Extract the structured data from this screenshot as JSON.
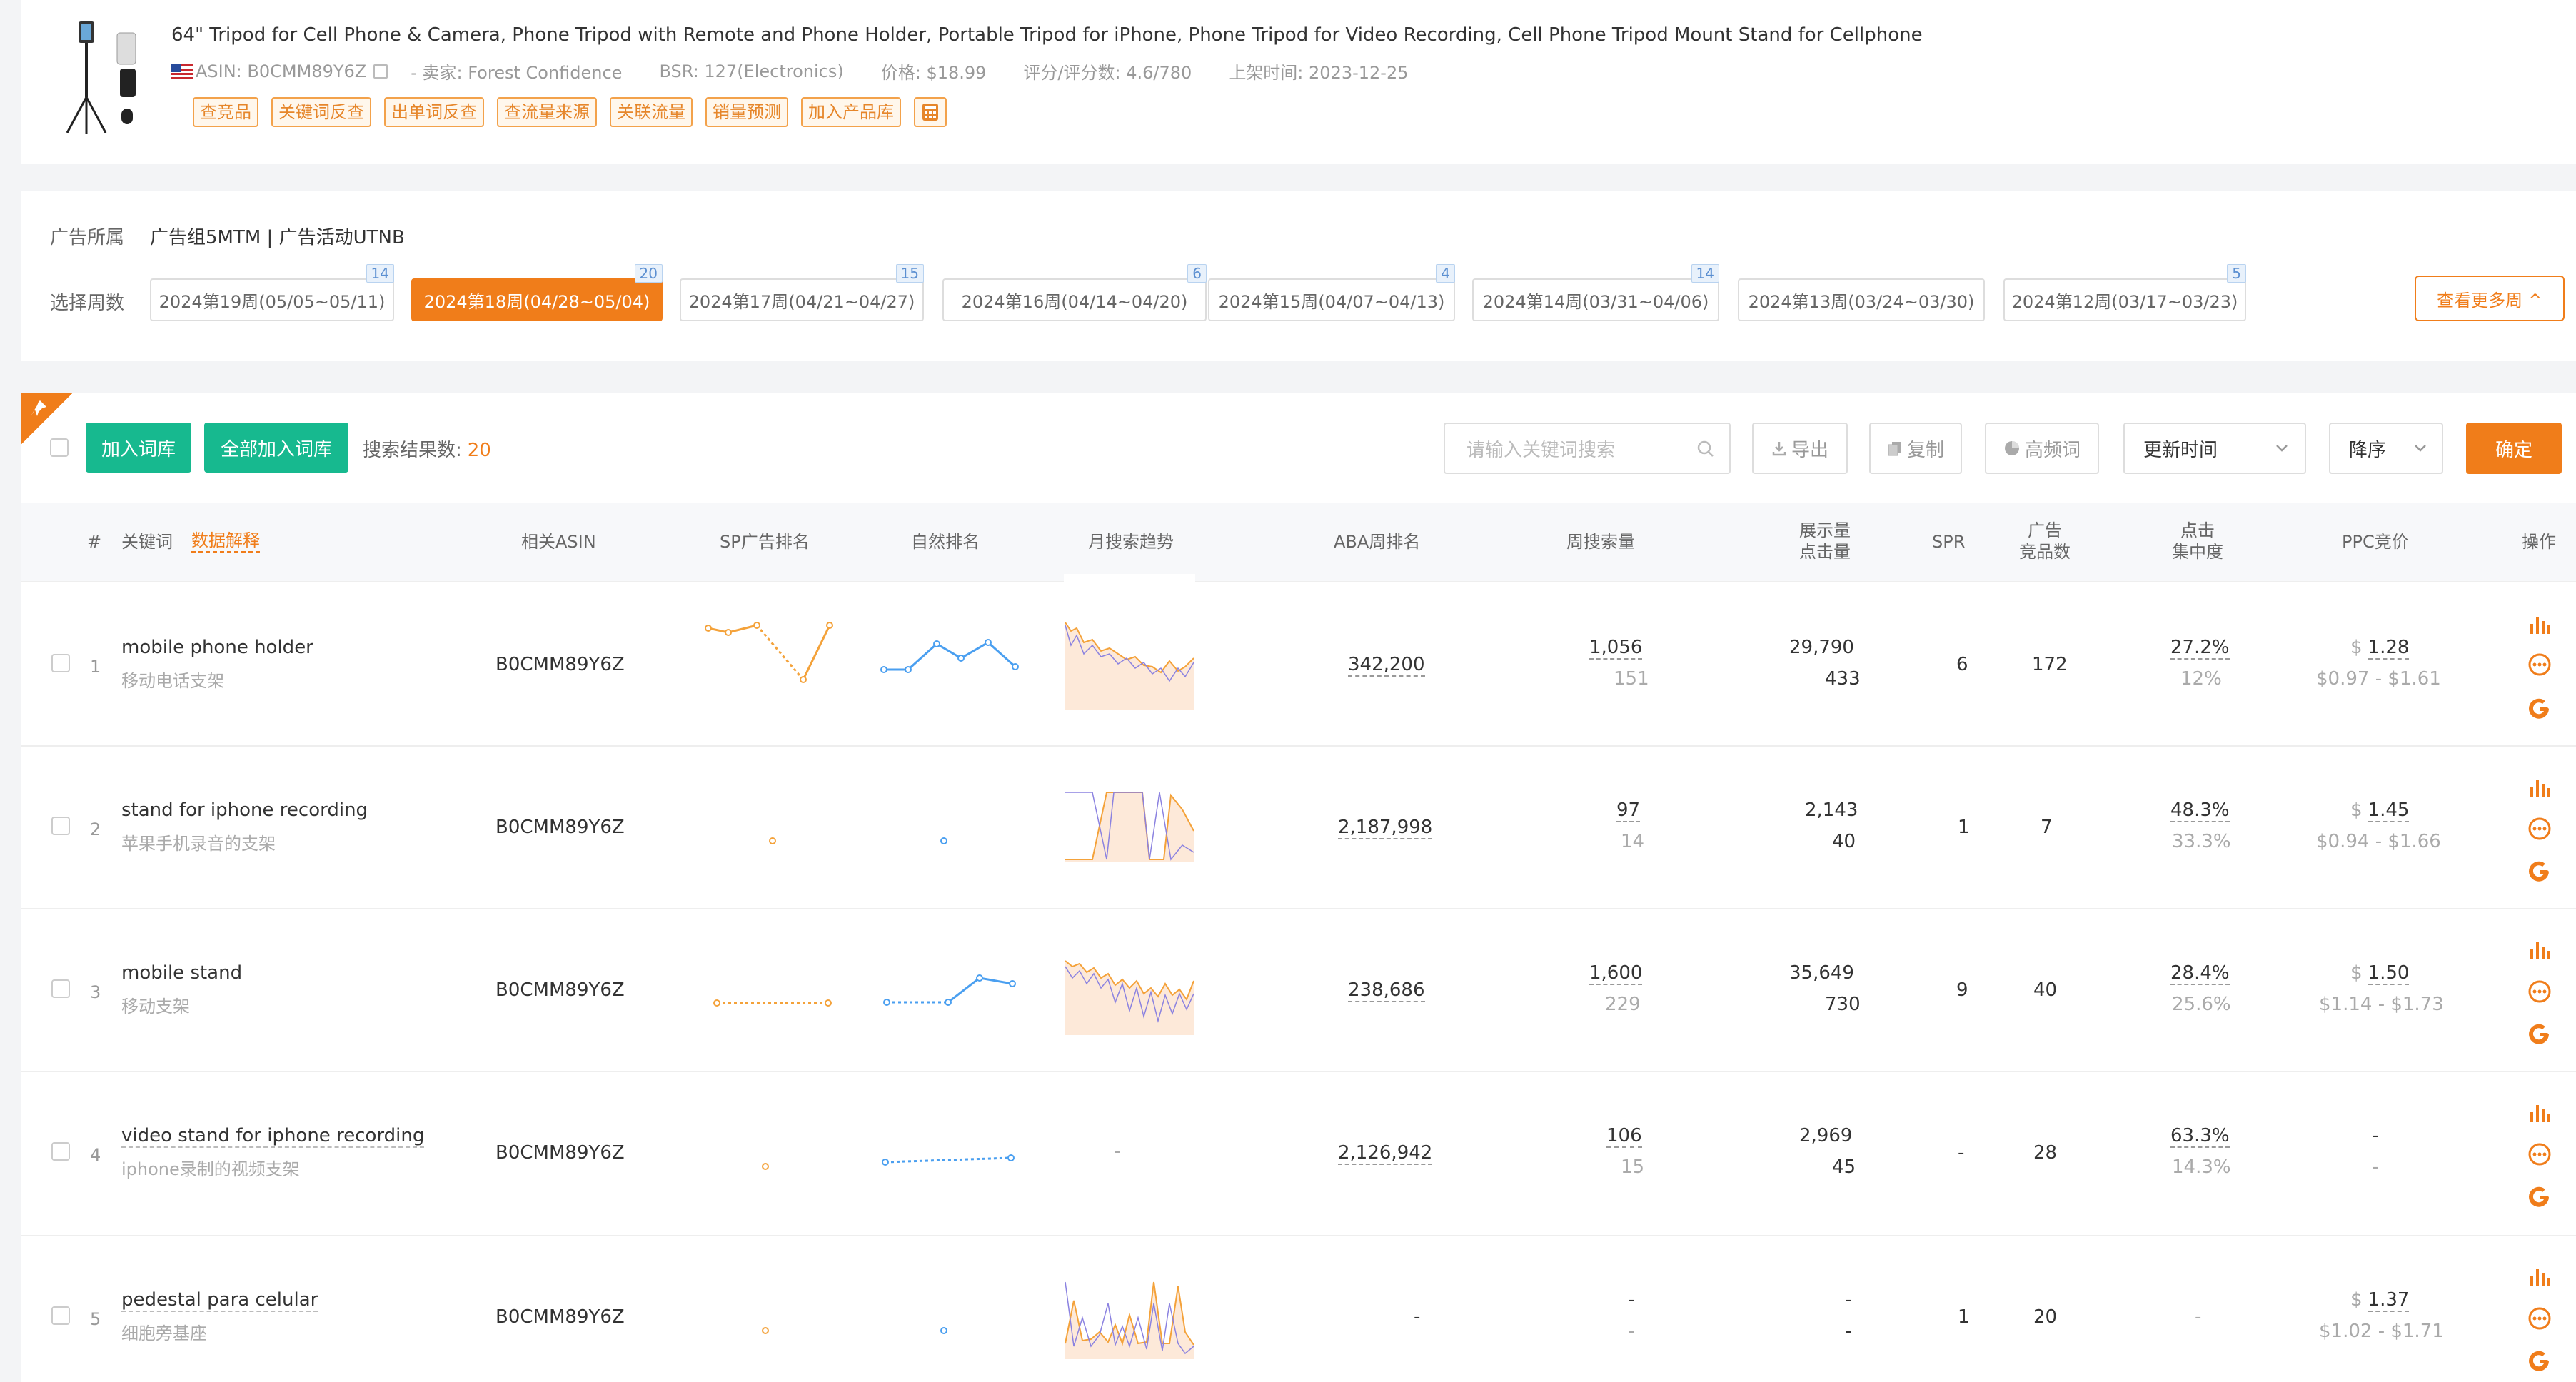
{
  "product": {
    "title": "64\" Tripod for Cell Phone & Camera, Phone Tripod with Remote and Phone Holder, Portable Tripod for iPhone, Phone Tripod for Video Recording, Cell Phone Tripod Mount Stand for Cellphone",
    "asin": "ASIN: B0CMM89Y6Z",
    "seller": "- 卖家: Forest Confidence",
    "bsr": "BSR: 127(Electronics)",
    "price": "价格: $18.99",
    "rating": "评分/评分数: 4.6/780",
    "listed": "上架时间: 2023-12-25",
    "tags": [
      "查竞品",
      "关键词反查",
      "出单词反查",
      "查流量来源",
      "关联流量",
      "销量预测",
      "加入产品库"
    ]
  },
  "ad": {
    "label": "广告所属",
    "group": "广告组5MTM | 广告活动UTNB",
    "week_label": "选择周数",
    "weeks": [
      {
        "label": "2024第19周(05/05~05/11)",
        "badge": "14"
      },
      {
        "label": "2024第18周(04/28~05/04)",
        "badge": "20"
      },
      {
        "label": "2024第17周(04/21~04/27)",
        "badge": "15"
      },
      {
        "label": "2024第16周(04/14~04/20)",
        "badge": "6"
      },
      {
        "label": "2024第15周(04/07~04/13)",
        "badge": "4"
      },
      {
        "label": "2024第14周(03/31~04/06)",
        "badge": "14"
      },
      {
        "label": "2024第13周(03/24~03/30)",
        "badge": ""
      },
      {
        "label": "2024第12周(03/17~03/23)",
        "badge": "5"
      }
    ],
    "active_week": 1,
    "more": "查看更多周 ^"
  },
  "toolbar": {
    "add_lib": "加入词库",
    "add_all_lib": "全部加入词库",
    "result_label": "搜索结果数:",
    "result_count": "20",
    "search_placeholder": "请输入关键词搜索",
    "export": "导出",
    "copy": "复制",
    "freq": "高频词",
    "sort_field": "更新时间",
    "sort_order": "降序",
    "confirm": "确定"
  },
  "columns": {
    "index": "#",
    "keyword": "关键词",
    "data_explain": "数据解释",
    "asin": "相关ASIN",
    "sp_rank": "SP广告排名",
    "natural_rank": "自然排名",
    "trend": "月搜索趋势",
    "aba": "ABA周排名",
    "weekly_search": "周搜索量",
    "impressions": "展示量",
    "clicks": "点击量",
    "spr": "SPR",
    "ad_products_1": "广告",
    "ad_products_2": "竞品数",
    "click_conc_1": "点击",
    "click_conc_2": "集中度",
    "ppc": "PPC竞价",
    "ops": "操作"
  },
  "rows": [
    {
      "idx": "1",
      "kw": "mobile phone holder",
      "kw_cn": "移动电话支架",
      "asin": "B0CMM89Y6Z",
      "aba": "342,200",
      "ws": "1,056",
      "ws_sub": "151",
      "imp": "29,790",
      "clk": "433",
      "spr": "6",
      "ads": "172",
      "cc": "27.2%",
      "cc_sub": "12%",
      "ppc": "1.28",
      "ppc_range": "$0.97 - $1.61"
    },
    {
      "idx": "2",
      "kw": "stand for iphone recording",
      "kw_cn": "苹果手机录音的支架",
      "asin": "B0CMM89Y6Z",
      "aba": "2,187,998",
      "ws": "97",
      "ws_sub": "14",
      "imp": "2,143",
      "clk": "40",
      "spr": "1",
      "ads": "7",
      "cc": "48.3%",
      "cc_sub": "33.3%",
      "ppc": "1.45",
      "ppc_range": "$0.94 - $1.66"
    },
    {
      "idx": "3",
      "kw": "mobile stand",
      "kw_cn": "移动支架",
      "asin": "B0CMM89Y6Z",
      "aba": "238,686",
      "ws": "1,600",
      "ws_sub": "229",
      "imp": "35,649",
      "clk": "730",
      "spr": "9",
      "ads": "40",
      "cc": "28.4%",
      "cc_sub": "25.6%",
      "ppc": "1.50",
      "ppc_range": "$1.14 - $1.73"
    },
    {
      "idx": "4",
      "kw": "video stand for iphone recording",
      "kw_cn": "iphone录制的视频支架",
      "asin": "B0CMM89Y6Z",
      "aba": "2,126,942",
      "ws": "106",
      "ws_sub": "15",
      "imp": "2,969",
      "clk": "45",
      "spr": "-",
      "ads": "28",
      "cc": "63.3%",
      "cc_sub": "14.3%",
      "ppc": "-",
      "ppc_range": "-"
    },
    {
      "idx": "5",
      "kw": "pedestal para celular",
      "kw_cn": "细胞旁基座",
      "asin": "B0CMM89Y6Z",
      "aba": "-",
      "ws": "-",
      "ws_sub": "-",
      "imp": "-",
      "clk": "-",
      "spr": "1",
      "ads": "20",
      "cc": "-",
      "cc_sub": "",
      "ppc": "1.37",
      "ppc_range": "$1.02 - $1.71"
    }
  ],
  "colors": {
    "accent": "#f07d1a",
    "green": "#17b98f",
    "blue": "#4a9ff0"
  }
}
